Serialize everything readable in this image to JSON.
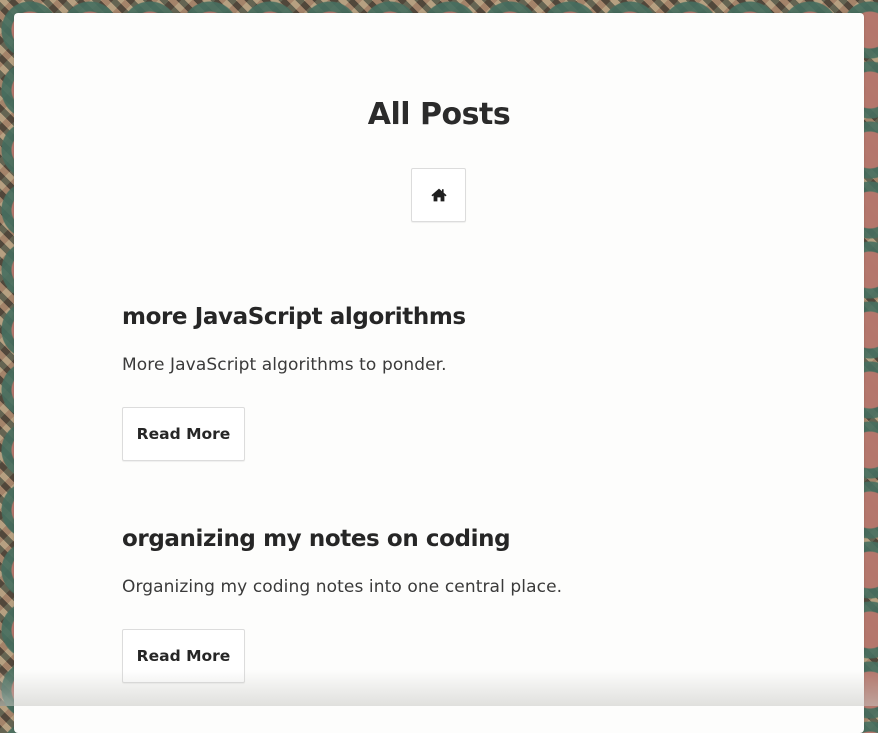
{
  "page": {
    "title": "All Posts"
  },
  "nav": {
    "home_icon": "home-icon"
  },
  "posts": [
    {
      "title": "more JavaScript algorithms",
      "excerpt": "More JavaScript algorithms to ponder.",
      "button_label": "Read More"
    },
    {
      "title": "organizing my notes on coding",
      "excerpt": "Organizing my coding notes into one central place.",
      "button_label": "Read More"
    }
  ],
  "colors": {
    "text": "#262626",
    "card": "#fdfdfc",
    "border": "#dcdcdc"
  }
}
